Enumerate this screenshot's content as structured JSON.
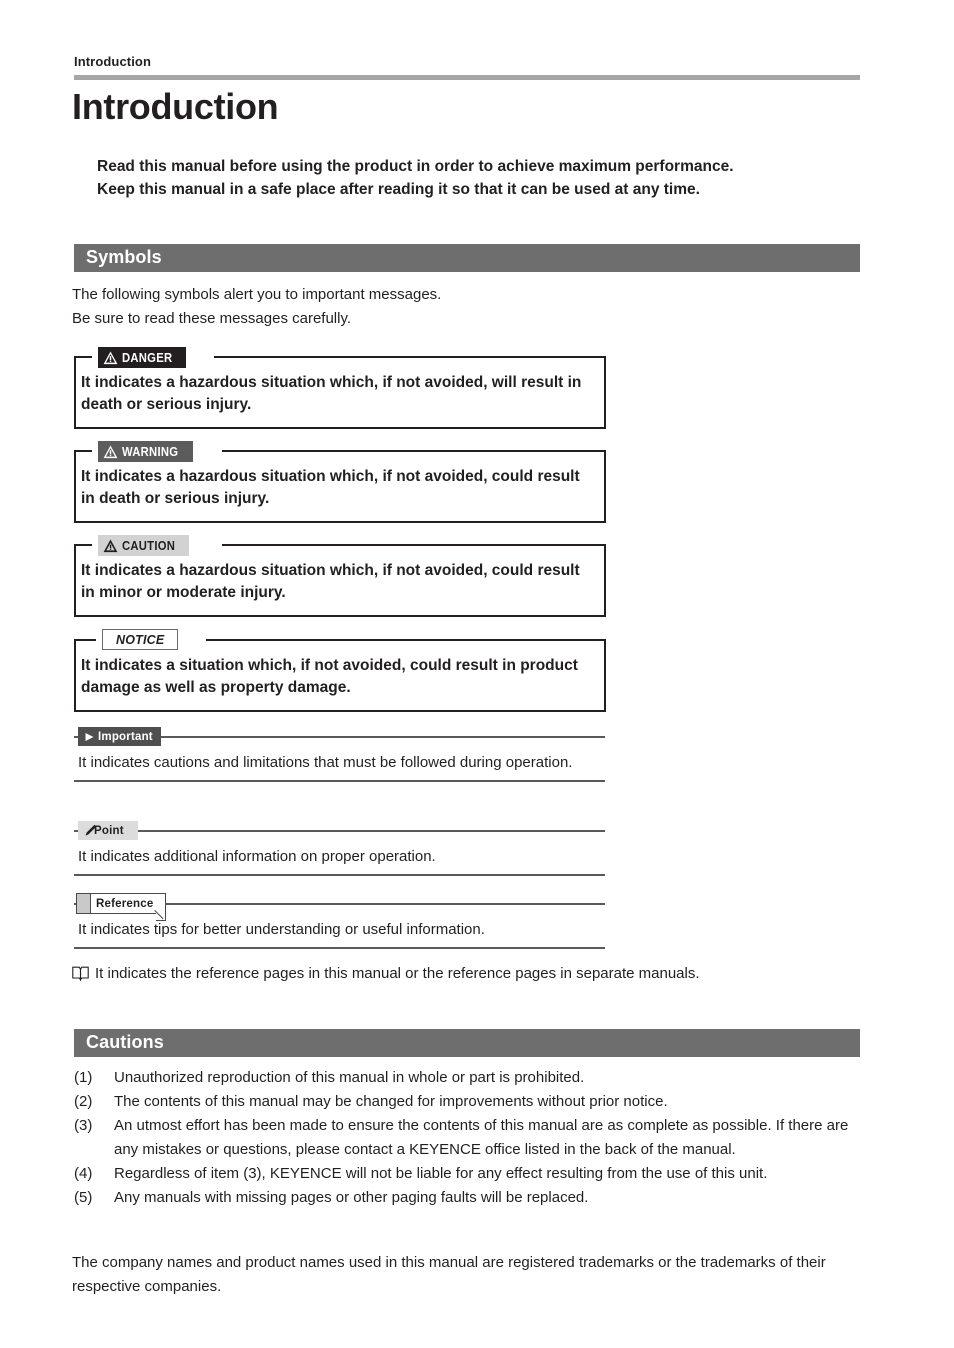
{
  "header": {
    "running_head": "Introduction"
  },
  "title": "Introduction",
  "lead": {
    "line1": "Read this manual before using the product in order to achieve maximum performance.",
    "line2": "Keep this manual in a safe place after reading it so that it can be used at any time."
  },
  "sections": {
    "symbols": {
      "heading": "Symbols",
      "intro_line1": "The following symbols alert you to important messages.",
      "intro_line2": "Be sure to read these messages carefully."
    },
    "cautions": {
      "heading": "Cautions"
    }
  },
  "alerts": [
    {
      "badge": "DANGER",
      "icon": "warning-triangle-icon",
      "text": "It indicates a hazardous situation which, if not avoided, will result in death or serious injury.",
      "badge_bg": "#231f20",
      "badge_fg": "#ffffff"
    },
    {
      "badge": "WARNING",
      "icon": "warning-triangle-icon",
      "text": "It indicates a hazardous situation which, if not avoided, could result in death or serious injury.",
      "badge_bg": "#5c5c5c",
      "badge_fg": "#ffffff"
    },
    {
      "badge": "CAUTION",
      "icon": "warning-triangle-icon",
      "text": "It indicates a hazardous situation which, if not avoided, could result in minor or moderate injury.",
      "badge_bg": "#d2d2d2",
      "badge_fg": "#231f20"
    },
    {
      "badge": "NOTICE",
      "icon": "none",
      "text": "It indicates a situation which, if not avoided, could result in product damage as well as property damage.",
      "badge_bg": "#ffffff",
      "badge_fg": "#231f20"
    }
  ],
  "notes": [
    {
      "tag": "Important",
      "icon": "play-triangle-icon",
      "text": "It indicates cautions and limitations that must be followed during operation."
    },
    {
      "tag": "Point",
      "icon": "pen-icon",
      "text": "It indicates additional information on proper operation."
    },
    {
      "tag": "Reference",
      "icon": "page-fold-icon",
      "text": "It indicates tips for better understanding or useful information."
    }
  ],
  "book_note": {
    "icon": "open-book-icon",
    "text": "It indicates the reference pages in this manual or the reference pages in separate manuals."
  },
  "cautions_list": [
    {
      "num": "(1)",
      "text": "Unauthorized reproduction of this manual in whole or part is prohibited."
    },
    {
      "num": "(2)",
      "text": "The contents of this manual may be changed for improvements without prior notice."
    },
    {
      "num": "(3)",
      "text": "An utmost effort has been made to ensure the contents of this manual are as complete as possible. If there are any mistakes or questions, please contact a KEYENCE office listed in the back of the manual."
    },
    {
      "num": "(4)",
      "text": "Regardless of item (3), KEYENCE will not be liable for any effect resulting from the use of this unit."
    },
    {
      "num": "(5)",
      "text": "Any manuals with missing pages or other paging faults will be replaced."
    }
  ],
  "trademark": "The company names and product names used in this manual are registered trademarks or the trademarks of their respective companies.",
  "colors": {
    "rule_grey": "#a6a6a6",
    "section_bar_grey": "#6e6e6e",
    "text": "#231f20"
  }
}
